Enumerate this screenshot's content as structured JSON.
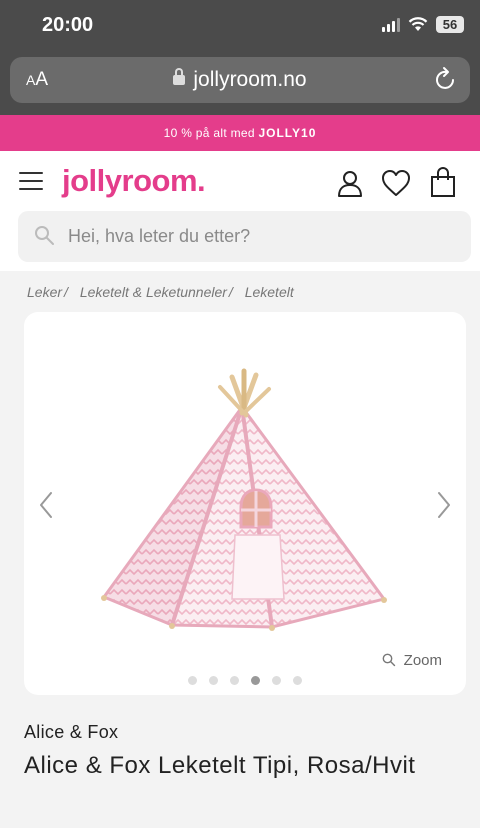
{
  "status_bar": {
    "time": "20:00",
    "battery": "56"
  },
  "browser": {
    "text_size": "AA",
    "url": "jollyroom.no"
  },
  "promo": {
    "text": "10 % på alt med ",
    "code": "JOLLY10"
  },
  "header": {
    "logo": "jollyroom.",
    "search_placeholder": "Hei, hva leter du etter?"
  },
  "breadcrumb": [
    {
      "label": "Leker"
    },
    {
      "label": "Leketelt & Leketunneler"
    },
    {
      "label": "Leketelt"
    }
  ],
  "gallery": {
    "zoom_label": "Zoom",
    "slide_count": 6,
    "active_slide": 4
  },
  "product": {
    "brand": "Alice & Fox",
    "title": "Alice & Fox Leketelt Tipi, Rosa/Hvit"
  },
  "colors": {
    "brand_pink": "#e43d8b",
    "tent_pink": "#f3c8d4",
    "tent_frame": "#e7a9bb"
  }
}
